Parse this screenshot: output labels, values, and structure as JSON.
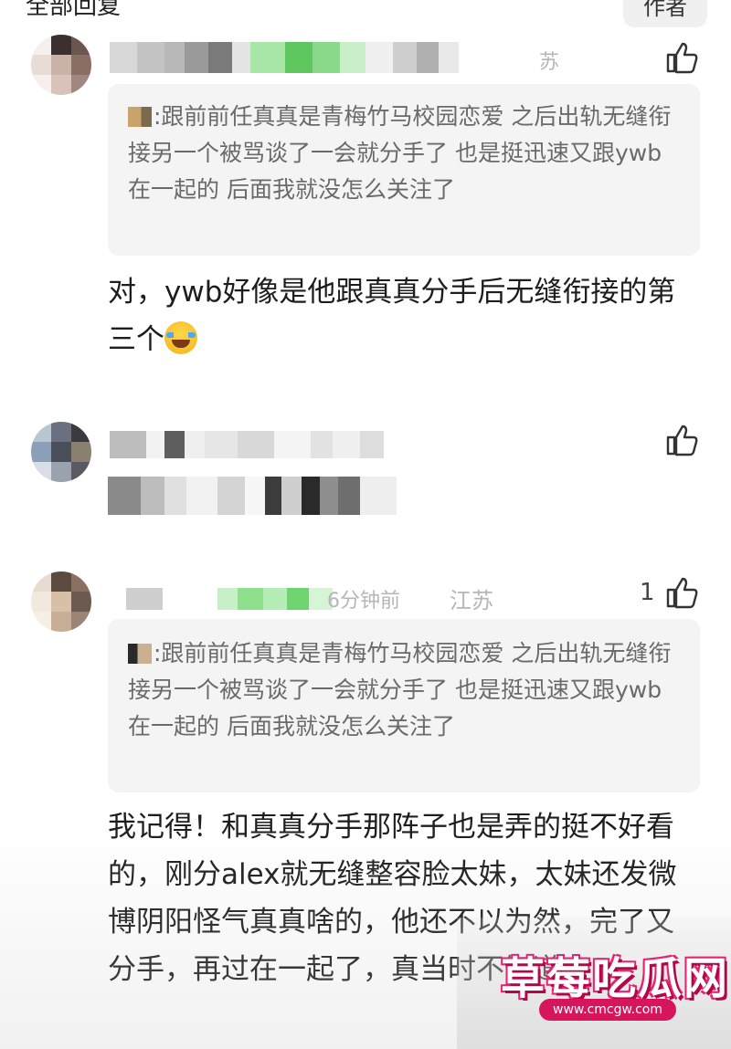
{
  "header": {
    "title": "全部回复",
    "author_button": "作者"
  },
  "colors": {
    "accent_pink": "#d6155c",
    "quote_bg": "#f4f4f4",
    "meta_gray": "#b6b6b6"
  },
  "comments": [
    {
      "meta_suffix": "苏",
      "like_icon": "thumbs-up-icon",
      "quote": {
        "text": ":跟前前任真真是青梅竹马校园恋爱 之后出轨无缝衔接另一个被骂谈了一会就分手了 也是挺迅速又跟ywb在一起的 后面我就没怎么关注了"
      },
      "reply_text": "对，ywb好像是他跟真真分手后无缝衔接的第三个",
      "emoji": "laughing-tears-emoji"
    },
    {
      "like_icon": "thumbs-up-icon"
    },
    {
      "meta_time": "6分钟前",
      "meta_location": "江苏",
      "like_count": "1",
      "like_icon": "thumbs-up-icon",
      "quote": {
        "text": ":跟前前任真真是青梅竹马校园恋爱 之后出轨无缝衔接另一个被骂谈了一会就分手了 也是挺迅速又跟ywb在一起的 后面我就没怎么关注了"
      },
      "reply_text": "我记得！和真真分手那阵子也是弄的挺不好看的，刚分alex就无缝整容脸太妹，太妹还发微博阴阳怪气真真啥的，他还不以为然，完了又分手，再过在一起了，真当时不知道"
    }
  ],
  "watermark": {
    "logo_text": "草莓吃瓜网",
    "url": "www.cmcgw.com"
  }
}
